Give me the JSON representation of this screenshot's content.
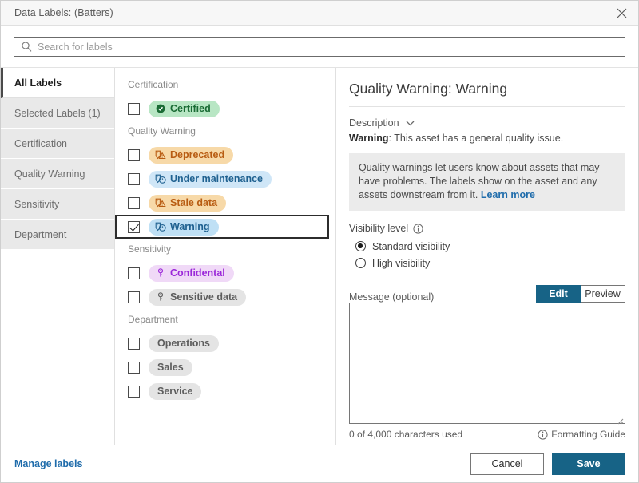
{
  "window": {
    "title": "Data Labels: (Batters)",
    "close_icon": "close-icon"
  },
  "search": {
    "icon": "search-icon",
    "placeholder": "Search for labels"
  },
  "sidebar": {
    "items": [
      {
        "label": "All Labels",
        "active": true
      },
      {
        "label": "Selected Labels (1)",
        "active": false
      },
      {
        "label": "Certification",
        "active": false
      },
      {
        "label": "Quality Warning",
        "active": false
      },
      {
        "label": "Sensitivity",
        "active": false
      },
      {
        "label": "Department",
        "active": false
      }
    ]
  },
  "label_list": {
    "groups": [
      {
        "title": "Certification",
        "items": [
          {
            "label": "Certified",
            "checked": false,
            "selected": false,
            "icon": "certified-badge-icon",
            "bg": "#b8e6c4",
            "fg": "#1a6b34"
          }
        ]
      },
      {
        "title": "Quality Warning",
        "items": [
          {
            "label": "Deprecated",
            "checked": false,
            "selected": false,
            "icon": "tag-warning-icon",
            "bg": "#f7d9a8",
            "fg": "#b85c12"
          },
          {
            "label": "Under maintenance",
            "checked": false,
            "selected": false,
            "icon": "tag-clock-icon",
            "bg": "#cfe6f7",
            "fg": "#1f6190"
          },
          {
            "label": "Stale data",
            "checked": false,
            "selected": false,
            "icon": "tag-warning-icon",
            "bg": "#f7d9a8",
            "fg": "#b85c12"
          },
          {
            "label": "Warning",
            "checked": true,
            "selected": true,
            "icon": "tag-clock-icon",
            "bg": "#bfe0f5",
            "fg": "#1f6190"
          }
        ]
      },
      {
        "title": "Sensitivity",
        "items": [
          {
            "label": "Confidental",
            "checked": false,
            "selected": false,
            "icon": "key-icon",
            "bg": "#f0d9f7",
            "fg": "#9b28d9"
          },
          {
            "label": "Sensitive data",
            "checked": false,
            "selected": false,
            "icon": "key-icon",
            "bg": "#e4e4e4",
            "fg": "#5d5d5d"
          }
        ]
      },
      {
        "title": "Department",
        "items": [
          {
            "label": "Operations",
            "checked": false,
            "selected": false,
            "icon": null,
            "bg": "#e4e4e4",
            "fg": "#5d5d5d"
          },
          {
            "label": "Sales",
            "checked": false,
            "selected": false,
            "icon": null,
            "bg": "#e4e4e4",
            "fg": "#5d5d5d"
          },
          {
            "label": "Service",
            "checked": false,
            "selected": false,
            "icon": null,
            "bg": "#e4e4e4",
            "fg": "#5d5d5d"
          }
        ]
      }
    ]
  },
  "detail": {
    "title": "Quality Warning: Warning",
    "description_toggle": "Description",
    "chevron_icon": "chevron-down-icon",
    "description_term": "Warning",
    "description_text": ": This asset has a general quality issue.",
    "info_text": "Quality warnings let users know about assets that may have problems. The labels show on the asset and any assets downstream from it.",
    "info_link": "Learn more",
    "visibility": {
      "label": "Visibility level",
      "info_icon": "info-icon",
      "options": [
        {
          "label": "Standard visibility",
          "selected": true
        },
        {
          "label": "High visibility",
          "selected": false
        }
      ]
    },
    "message": {
      "label": "Message (optional)",
      "value": "",
      "tabs": [
        {
          "label": "Edit",
          "active": true
        },
        {
          "label": "Preview",
          "active": false
        }
      ],
      "char_count": "0 of 4,000 characters used",
      "formatting_guide": "Formatting Guide",
      "formatting_icon": "info-icon"
    }
  },
  "footer": {
    "manage_labels": "Manage labels",
    "cancel": "Cancel",
    "save": "Save"
  },
  "colors": {
    "accent": "#176386",
    "link": "#1f6cab"
  }
}
